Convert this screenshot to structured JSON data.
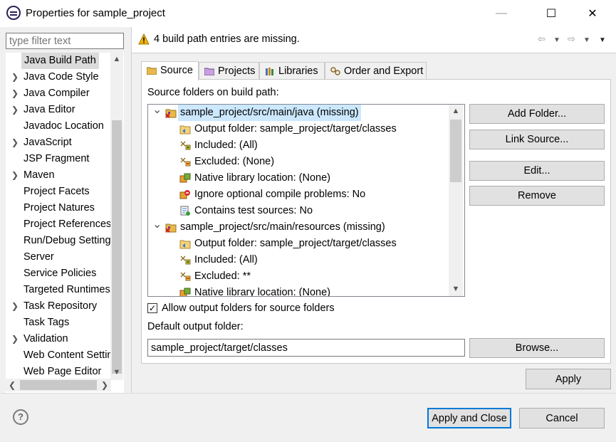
{
  "window": {
    "title": "Properties for sample_project",
    "min_glyph": "—",
    "max_glyph": "☐",
    "close_glyph": "✕"
  },
  "filter": {
    "placeholder": "type filter text"
  },
  "sidebar": {
    "items": [
      {
        "label": "Java Build Path",
        "expandable": false,
        "selected": true
      },
      {
        "label": "Java Code Style",
        "expandable": true
      },
      {
        "label": "Java Compiler",
        "expandable": true
      },
      {
        "label": "Java Editor",
        "expandable": true
      },
      {
        "label": "Javadoc Location",
        "expandable": false
      },
      {
        "label": "JavaScript",
        "expandable": true
      },
      {
        "label": "JSP Fragment",
        "expandable": false
      },
      {
        "label": "Maven",
        "expandable": true
      },
      {
        "label": "Project Facets",
        "expandable": false
      },
      {
        "label": "Project Natures",
        "expandable": false
      },
      {
        "label": "Project References",
        "expandable": false
      },
      {
        "label": "Run/Debug Settings",
        "expandable": false
      },
      {
        "label": "Server",
        "expandable": false
      },
      {
        "label": "Service Policies",
        "expandable": false
      },
      {
        "label": "Targeted Runtimes",
        "expandable": false
      },
      {
        "label": "Task Repository",
        "expandable": true
      },
      {
        "label": "Task Tags",
        "expandable": false
      },
      {
        "label": "Validation",
        "expandable": true
      },
      {
        "label": "Web Content Settings",
        "expandable": false
      },
      {
        "label": "Web Page Editor",
        "expandable": false
      }
    ]
  },
  "header": {
    "message": "4 build path entries are missing."
  },
  "tabs": [
    {
      "label": "Source",
      "active": true
    },
    {
      "label": "Projects"
    },
    {
      "label": "Libraries"
    },
    {
      "label": "Order and Export"
    }
  ],
  "source": {
    "label": "Source folders on build path:",
    "rows": [
      {
        "level": 0,
        "text": "sample_project/src/main/java (missing)",
        "icon": "missing-source-folder-icon",
        "selected": true
      },
      {
        "level": 1,
        "text": "Output folder: sample_project/target/classes",
        "icon": "output-folder-icon"
      },
      {
        "level": 1,
        "text": "Included: (All)",
        "icon": "inclusion-filter-icon"
      },
      {
        "level": 1,
        "text": "Excluded: (None)",
        "icon": "exclusion-filter-icon"
      },
      {
        "level": 1,
        "text": "Native library location: (None)",
        "icon": "native-library-icon"
      },
      {
        "level": 1,
        "text": "Ignore optional compile problems: No",
        "icon": "ignore-problems-icon"
      },
      {
        "level": 1,
        "text": "Contains test sources: No",
        "icon": "test-sources-icon"
      },
      {
        "level": 0,
        "text": "sample_project/src/main/resources (missing)",
        "icon": "missing-source-folder-icon"
      },
      {
        "level": 1,
        "text": "Output folder: sample_project/target/classes",
        "icon": "output-folder-icon"
      },
      {
        "level": 1,
        "text": "Included: (All)",
        "icon": "inclusion-filter-icon"
      },
      {
        "level": 1,
        "text": "Excluded: **",
        "icon": "exclusion-filter-icon"
      },
      {
        "level": 1,
        "text": "Native library location: (None)",
        "icon": "native-library-icon"
      }
    ],
    "buttons": {
      "add_folder": "Add Folder...",
      "link_source": "Link Source...",
      "edit": "Edit...",
      "remove": "Remove"
    },
    "allow_output_label": "Allow output folders for source folders",
    "allow_output_checked": true,
    "default_output_label": "Default output folder:",
    "default_output_value": "sample_project/target/classes",
    "browse": "Browse..."
  },
  "footer": {
    "apply": "Apply",
    "apply_close": "Apply and Close",
    "cancel": "Cancel",
    "help_glyph": "?"
  },
  "colors": {
    "selection": "#cce8ff",
    "accent": "#0078d7",
    "missing_marker": "#d02020"
  }
}
